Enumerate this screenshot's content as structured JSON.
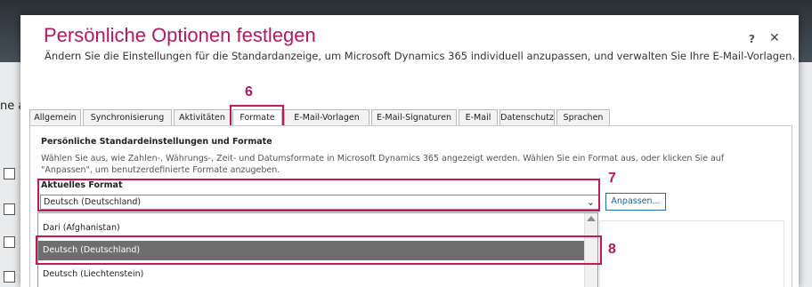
{
  "background": {
    "partial_text": "ne ak"
  },
  "dialog": {
    "title": "Persönliche Optionen festlegen",
    "subtitle": "Ändern Sie die Einstellungen für die Standardanzeige, um Microsoft Dynamics 365 individuell anzupassen, und verwalten Sie Ihre E-Mail-Vorlagen.",
    "help_label": "?",
    "close_label": "✕"
  },
  "callouts": {
    "c6": "6",
    "c7": "7",
    "c8": "8"
  },
  "tabs": [
    {
      "label": "Allgemein"
    },
    {
      "label": "Synchronisierung"
    },
    {
      "label": "Aktivitäten"
    },
    {
      "label": "Formate"
    },
    {
      "label": "E-Mail-Vorlagen"
    },
    {
      "label": "E-Mail-Signaturen"
    },
    {
      "label": "E-Mail"
    },
    {
      "label": "Datenschutz"
    },
    {
      "label": "Sprachen"
    }
  ],
  "active_tab": "Formate",
  "formats": {
    "heading": "Persönliche Standardeinstellungen und Formate",
    "description": "Wählen Sie aus, wie Zahlen-, Währungs-, Zeit- und Datumsformate in Microsoft Dynamics 365 angezeigt werden. Wählen Sie ein Format aus, oder klicken Sie auf \"Anpassen\", um benutzerdefinierte Formate anzugeben.",
    "current_label": "Aktuelles Format",
    "current_value": "Deutsch (Deutschland)",
    "customize_label": "Anpassen..."
  },
  "dropdown": {
    "options": [
      {
        "label": "Dari (Afghanistan)"
      },
      {
        "label": "Deutsch (Deutschland)"
      },
      {
        "label": "Deutsch (Liechtenstein)"
      }
    ],
    "selected": "Deutsch (Deutschland)"
  },
  "colors": {
    "accent": "#b2195f",
    "callout_border": "#c2185b",
    "selected_option_bg": "#6e6e6e",
    "link_blue": "#1e5fa0"
  }
}
